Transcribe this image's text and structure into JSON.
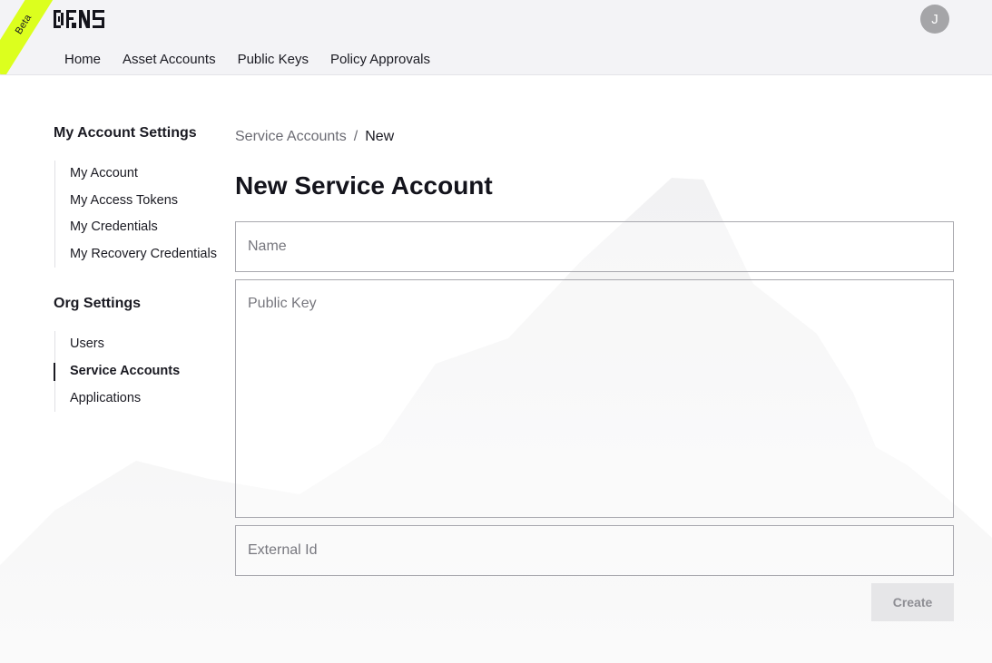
{
  "header": {
    "beta_label": "Beta",
    "logo_text": "DFNS",
    "avatar_initial": "J",
    "nav": [
      {
        "label": "Home"
      },
      {
        "label": "Asset Accounts"
      },
      {
        "label": "Public Keys"
      },
      {
        "label": "Policy Approvals"
      }
    ]
  },
  "sidebar": {
    "account_heading": "My Account Settings",
    "account_items": [
      {
        "label": "My Account"
      },
      {
        "label": "My Access Tokens"
      },
      {
        "label": "My Credentials"
      },
      {
        "label": "My Recovery Credentials"
      }
    ],
    "org_heading": "Org Settings",
    "org_items": [
      {
        "label": "Users"
      },
      {
        "label": "Service Accounts",
        "active": true
      },
      {
        "label": "Applications"
      }
    ]
  },
  "main": {
    "breadcrumb": {
      "parent": "Service Accounts",
      "separator": "/",
      "current": "New"
    },
    "title": "New Service Account",
    "form": {
      "name_placeholder": "Name",
      "name_value": "",
      "public_key_placeholder": "Public Key",
      "public_key_value": "",
      "external_id_placeholder": "External Id",
      "external_id_value": "",
      "submit_label": "Create",
      "submit_disabled": true
    }
  },
  "colors": {
    "accent_beta": "#dcff1e",
    "header_bg": "#f3f3f6",
    "text": "#1a1a22",
    "button_disabled_bg": "#e6e6e8"
  }
}
